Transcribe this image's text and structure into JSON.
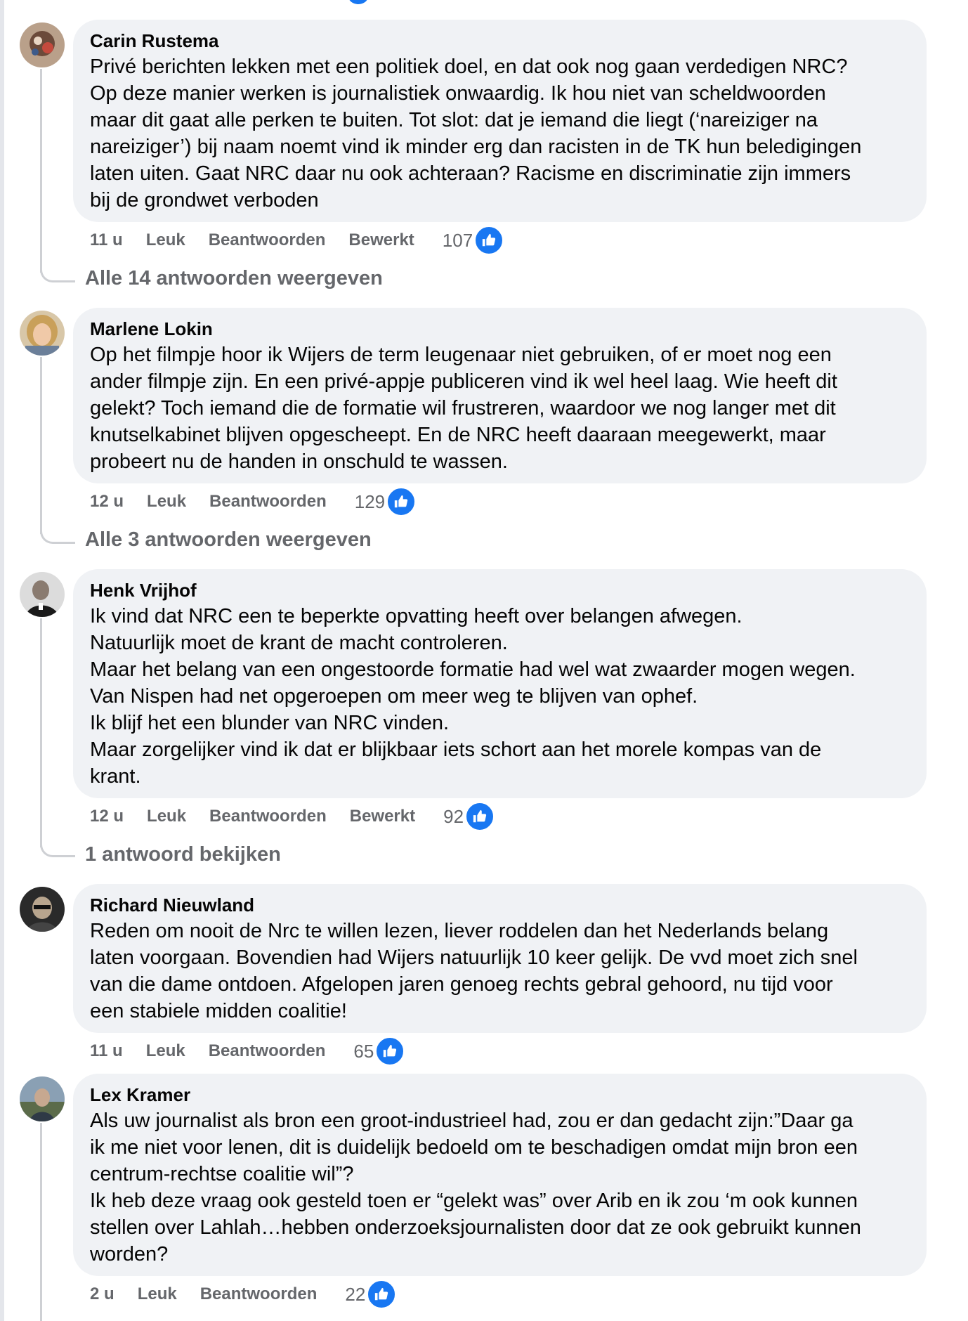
{
  "comments": [
    {
      "author": "Carin Rustema",
      "text": "Privé berichten lekken met een politiek doel, en dat ook nog gaan verdedigen NRC?\nOp deze manier werken is journalistiek onwaardig. Ik hou niet van scheldwoorden\nmaar dit gaat alle perken te buiten. Tot slot: dat je iemand die liegt (‘nareiziger na\nnareiziger’) bij naam noemt vind ik minder erg dan racisten in de TK hun beledigingen\nlaten uiten. Gaat NRC daar nu ook achteraan? Racisme en discriminatie zijn immers\nbij de grondwet verboden",
      "time": "11 u",
      "like": "Leuk",
      "reply": "Beantwoorden",
      "edited": "Bewerkt",
      "likes": "107",
      "replies_link": "Alle 14 antwoorden weergeven"
    },
    {
      "author": "Marlene Lokin",
      "text": "Op het filmpje hoor ik Wijers de term leugenaar niet gebruiken, of er moet nog een\nander filmpje zijn. En een privé-appje publiceren vind ik wel heel laag. Wie heeft dit\ngelekt? Toch iemand die de formatie wil frustreren, waardoor we nog langer met dit\nknutselkabinet blijven opgescheept. En de NRC heeft daaraan meegewerkt, maar\nprobeert nu de handen in onschuld te wassen.",
      "time": "12 u",
      "like": "Leuk",
      "reply": "Beantwoorden",
      "likes": "129",
      "replies_link": "Alle 3 antwoorden weergeven"
    },
    {
      "author": "Henk Vrijhof",
      "text": "Ik vind dat NRC een te beperkte opvatting heeft over belangen afwegen.\nNatuurlijk moet de krant de macht controleren.\nMaar het belang van een ongestoorde formatie had wel wat zwaarder mogen wegen.\nVan Nispen had net opgeroepen om meer weg te blijven van ophef.\nIk blijf het een blunder van NRC vinden.\nMaar zorgelijker vind ik dat er blijkbaar iets schort aan het morele kompas van de\nkrant.",
      "time": "12 u",
      "like": "Leuk",
      "reply": "Beantwoorden",
      "edited": "Bewerkt",
      "likes": "92",
      "replies_link": "1 antwoord bekijken"
    },
    {
      "author": "Richard Nieuwland",
      "text": "Reden om nooit de Nrc te willen lezen, liever roddelen dan het Nederlands belang\nlaten voorgaan. Bovendien had Wijers natuurlijk 10 keer gelijk. De vvd moet zich snel\nvan die dame ontdoen. Afgelopen jaren genoeg rechts gebral gehoord, nu tijd voor\neen stabiele midden coalitie!",
      "time": "11 u",
      "like": "Leuk",
      "reply": "Beantwoorden",
      "likes": "65"
    },
    {
      "author": "Lex Kramer",
      "text": "Als uw journalist als bron een groot-industrieel had, zou er dan gedacht zijn:”Daar ga\nik me niet voor lenen, dit is duidelijk bedoeld om te beschadigen omdat mijn bron een\ncentrum-rechtse coalitie wil”?\nIk heb deze vraag ook gesteld toen er “gelekt was” over Arib en ik zou ‘m ook kunnen\nstellen over Lahlah…hebben onderzoeksjournalisten door dat ze ook gebruikt kunnen\nworden?",
      "time": "2 u",
      "like": "Leuk",
      "reply": "Beantwoorden",
      "likes": "22"
    }
  ],
  "colors": {
    "bubble": "#f0f2f5",
    "meta": "#65676b",
    "like_blue": "#1877f2"
  },
  "icons": [
    "thumbs-up-icon",
    "avatar"
  ]
}
